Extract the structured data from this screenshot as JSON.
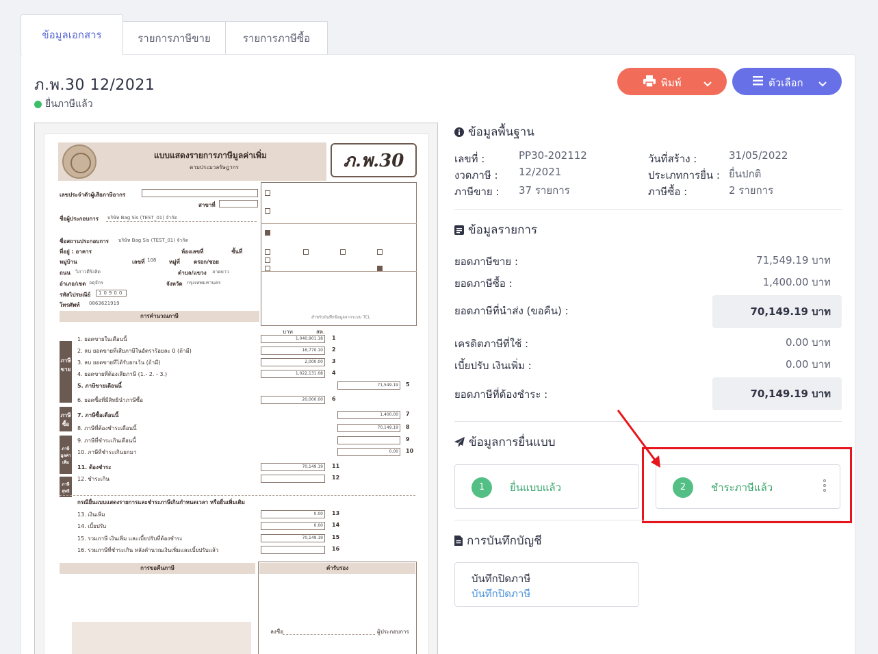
{
  "tabs": [
    {
      "label": "ข้อมูลเอกสาร",
      "active": true
    },
    {
      "label": "รายการภาษีขาย",
      "active": false
    },
    {
      "label": "รายการภาษีซื้อ",
      "active": false
    }
  ],
  "header": {
    "title": "ภ.พ.30 12/2021",
    "status": "ยื่นภาษีแล้ว",
    "status_color": "#3bbf6a",
    "print_label": "พิมพ์",
    "options_label": "ตัวเลือก"
  },
  "basic": {
    "heading": "ข้อมูลพื้นฐาน",
    "number_label": "เลขที่ :",
    "number_value": "PP30-202112",
    "created_label": "วันที่สร้าง :",
    "created_value": "31/05/2022",
    "period_label": "งวดภาษี :",
    "period_value": "12/2021",
    "filing_type_label": "ประเภทการยื่น :",
    "filing_type_value": "ยื่นปกติ",
    "sales_tax_label": "ภาษีขาย :",
    "sales_tax_value": "37 รายการ",
    "purchase_tax_label": "ภาษีซื้อ :",
    "purchase_tax_value": "2 รายการ"
  },
  "items": {
    "heading": "ข้อมูลรายการ",
    "rows": [
      {
        "label": "ยอดภาษีขาย :",
        "value": "71,549.19 บาท",
        "boxed": false
      },
      {
        "label": "ยอดภาษีซื้อ :",
        "value": "1,400.00 บาท",
        "boxed": false
      },
      {
        "label": "ยอดภาษีที่นำส่ง (ขอคืน) :",
        "value": "70,149.19 บาท",
        "boxed": true
      },
      {
        "label": "เครดิตภาษีที่ใช้ :",
        "value": "0.00 บาท",
        "boxed": false
      },
      {
        "label": "เบี้ยปรับ เงินเพิ่ม :",
        "value": "0.00 บาท",
        "boxed": false
      },
      {
        "label": "ยอดภาษีที่ต้องชำระ :",
        "value": "70,149.19 บาท",
        "boxed": true
      }
    ]
  },
  "filing": {
    "heading": "ข้อมูลการยื่นแบบ",
    "steps": [
      {
        "number": "1",
        "label": "ยื่นแบบแล้ว"
      },
      {
        "number": "2",
        "label": "ชำระภาษีแล้ว"
      }
    ]
  },
  "accounting": {
    "heading": "การบันทึกบัญชี",
    "title": "บันทึกปิดภาษี",
    "link": "บันทึกปิดภาษี"
  },
  "form": {
    "title": "แบบแสดงรายการภาษีมูลค่าเพิ่ม",
    "subtitle": "ตามประมวลรัษฎากร",
    "code": "ภ.พ.30",
    "taxpayer_id_label": "เลขประจำตัวผู้เสียภาษีอากร",
    "branch_label": "สาขาที่",
    "operator_label": "ชื่อผู้ประกอบการ",
    "operator_value": "บริษัท Bag Sis (TEST_01) จำกัด",
    "business_label": "ชื่อสถานประกอบการ",
    "business_value": "บริษัท Bag Sis (TEST_01) จำกัด",
    "address_label": "ที่อยู่ : อาคาร",
    "room_label": "ห้องเลขที่",
    "floor_label": "ชั้นที่",
    "village_label": "หมู่บ้าน",
    "house_no_label": "เลขที่",
    "house_no_value": "108",
    "moo_label": "หมู่ที่",
    "soi_label": "ตรอก/ซอย",
    "road_label": "ถนน",
    "road_value": "วิภาวดีรังสิต",
    "subdistrict_label": "ตำบล/แขวง",
    "subdistrict_value": "ลาดยาว",
    "district_label": "อำเภอ/เขต",
    "district_value": "จตุจักร",
    "province_label": "จังหวัด",
    "province_value": "กรุงเทพมหานคร",
    "zip_label": "รหัสไปรษณีย์",
    "zip_value": "10900",
    "phone_label": "โทรศัพท์",
    "phone_value": "0863621919",
    "calc_bar": "การคำนวณภาษี",
    "unit_baht": "บาท",
    "unit_satang": "สต.",
    "refund_bar": "การขอคืนภาษี",
    "cert_bar": "คำรับรอง",
    "side_sell": "ภาษีขาย",
    "side_buy": "ภาษีซื้อ",
    "side_net": "ภาษีมูลค่าเพิ่ม",
    "side_net2": "ภาษีสุทธิ",
    "lines": [
      {
        "label": "1. ยอดขายในเดือนนี้",
        "value": "1,040,901.18",
        "no": "1"
      },
      {
        "label": "2. ลบ ยอดขายที่เสียภาษีในอัตราร้อยละ 0 (ถ้ามี)",
        "value": "16,770.10",
        "no": "2"
      },
      {
        "label": "3. ลบ ยอดขายที่ได้รับยกเว้น (ถ้ามี)",
        "value": "2,000.00",
        "no": "3"
      },
      {
        "label": "4. ยอดขายที่ต้องเสียภาษี (1.- 2. - 3.)",
        "value": "1,022,131.08",
        "no": "4"
      },
      {
        "label": "5. ภาษีขายเดือนนี้",
        "value": "71,549.19",
        "no": "5"
      },
      {
        "label": "6. ยอดซื้อที่มีสิทธินำภาษีซื้อ",
        "value": "20,000.00",
        "no": "6"
      },
      {
        "label": "7. ภาษีซื้อเดือนนี้",
        "value": "1,400.00",
        "no": "7"
      },
      {
        "label": "8. ภาษีที่ต้องชำระเดือนนี้",
        "value": "70,149.19",
        "no": "8"
      },
      {
        "label": "9. ภาษีที่ชำระเกินเดือนนี้",
        "value": "",
        "no": "9"
      },
      {
        "label": "10. ภาษีที่ชำระเกินยกมา",
        "value": "0.00",
        "no": "10"
      },
      {
        "label": "11. ต้องชำระ",
        "value": "70,149.19",
        "no": "11"
      },
      {
        "label": "12. ชำระเกิน",
        "value": "",
        "no": "12"
      },
      {
        "label": "13. เงินเพิ่ม",
        "value": "0.00",
        "no": "13"
      },
      {
        "label": "14. เบี้ยปรับ",
        "value": "0.00",
        "no": "14"
      },
      {
        "label": "15. รวมภาษี เงินเพิ่ม และเบี้ยปรับที่ต้องชำระ",
        "value": "70,149.19",
        "no": "15"
      },
      {
        "label": "16. รวมภาษีที่ชำระเกิน หลังคำนวณเงินเพิ่มและเบี้ยปรับแล้ว",
        "value": "",
        "no": "16"
      }
    ],
    "late_note": "กรณียื่นแบบแสดงรายการและชำระภาษีเกินกำหนดเวลา หรือยื่นเพิ่มเติม",
    "stamp_note": "สำหรับบันทึกข้อมูลจากระบบ TCL",
    "sign_label": "ลงชื่อ",
    "operator_sign": "ผู้ประกอบการ"
  }
}
